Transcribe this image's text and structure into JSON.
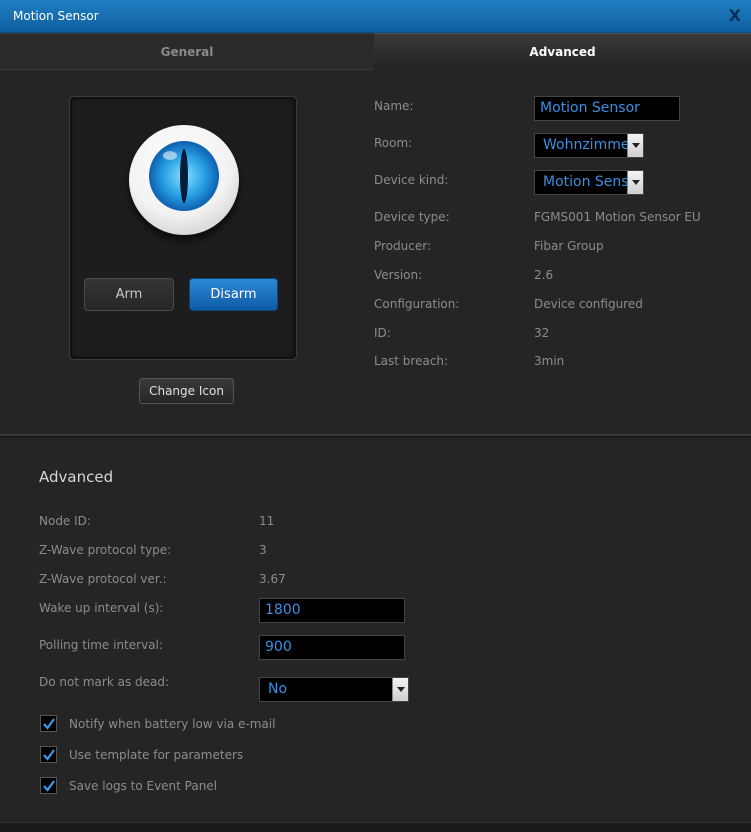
{
  "window": {
    "title": "Motion Sensor",
    "close_label": "X"
  },
  "tabs": [
    {
      "label": "General"
    },
    {
      "label": "Advanced"
    }
  ],
  "device_panel": {
    "arm_label": "Arm",
    "disarm_label": "Disarm",
    "change_icon_label": "Change Icon"
  },
  "device_info": {
    "name_label": "Name:",
    "name_value": "Motion Sensor",
    "room_label": "Room:",
    "room_value": "Wohnzimmer",
    "kind_label": "Device kind:",
    "kind_value": "Motion Sensor",
    "type_label": "Device type:",
    "type_value": "FGMS001 Motion Sensor EU",
    "producer_label": "Producer:",
    "producer_value": "Fibar Group",
    "version_label": "Version:",
    "version_value": "2.6",
    "config_label": "Configuration:",
    "config_value": "Device configured",
    "id_label": "ID:",
    "id_value": "32",
    "breach_label": "Last breach:",
    "breach_value": "3min"
  },
  "advanced": {
    "title": "Advanced",
    "node_id_label": "Node ID:",
    "node_id_value": "11",
    "protocol_type_label": "Z-Wave protocol type:",
    "protocol_type_value": "3",
    "protocol_ver_label": "Z-Wave protocol ver.:",
    "protocol_ver_value": "3.67",
    "wakeup_label": "Wake up interval (s):",
    "wakeup_value": "1800",
    "polling_label": "Polling time interval:",
    "polling_value": "900",
    "dead_label": "Do not mark as dead:",
    "dead_value": "No",
    "checkboxes": [
      {
        "label": "Notify when battery low via e-mail",
        "checked": true
      },
      {
        "label": "Use template for parameters",
        "checked": true
      },
      {
        "label": "Save logs to Event Panel",
        "checked": true
      }
    ]
  },
  "colors": {
    "accent": "#1f7fc2",
    "field_text": "#3b8fe0",
    "background": "#252525"
  }
}
